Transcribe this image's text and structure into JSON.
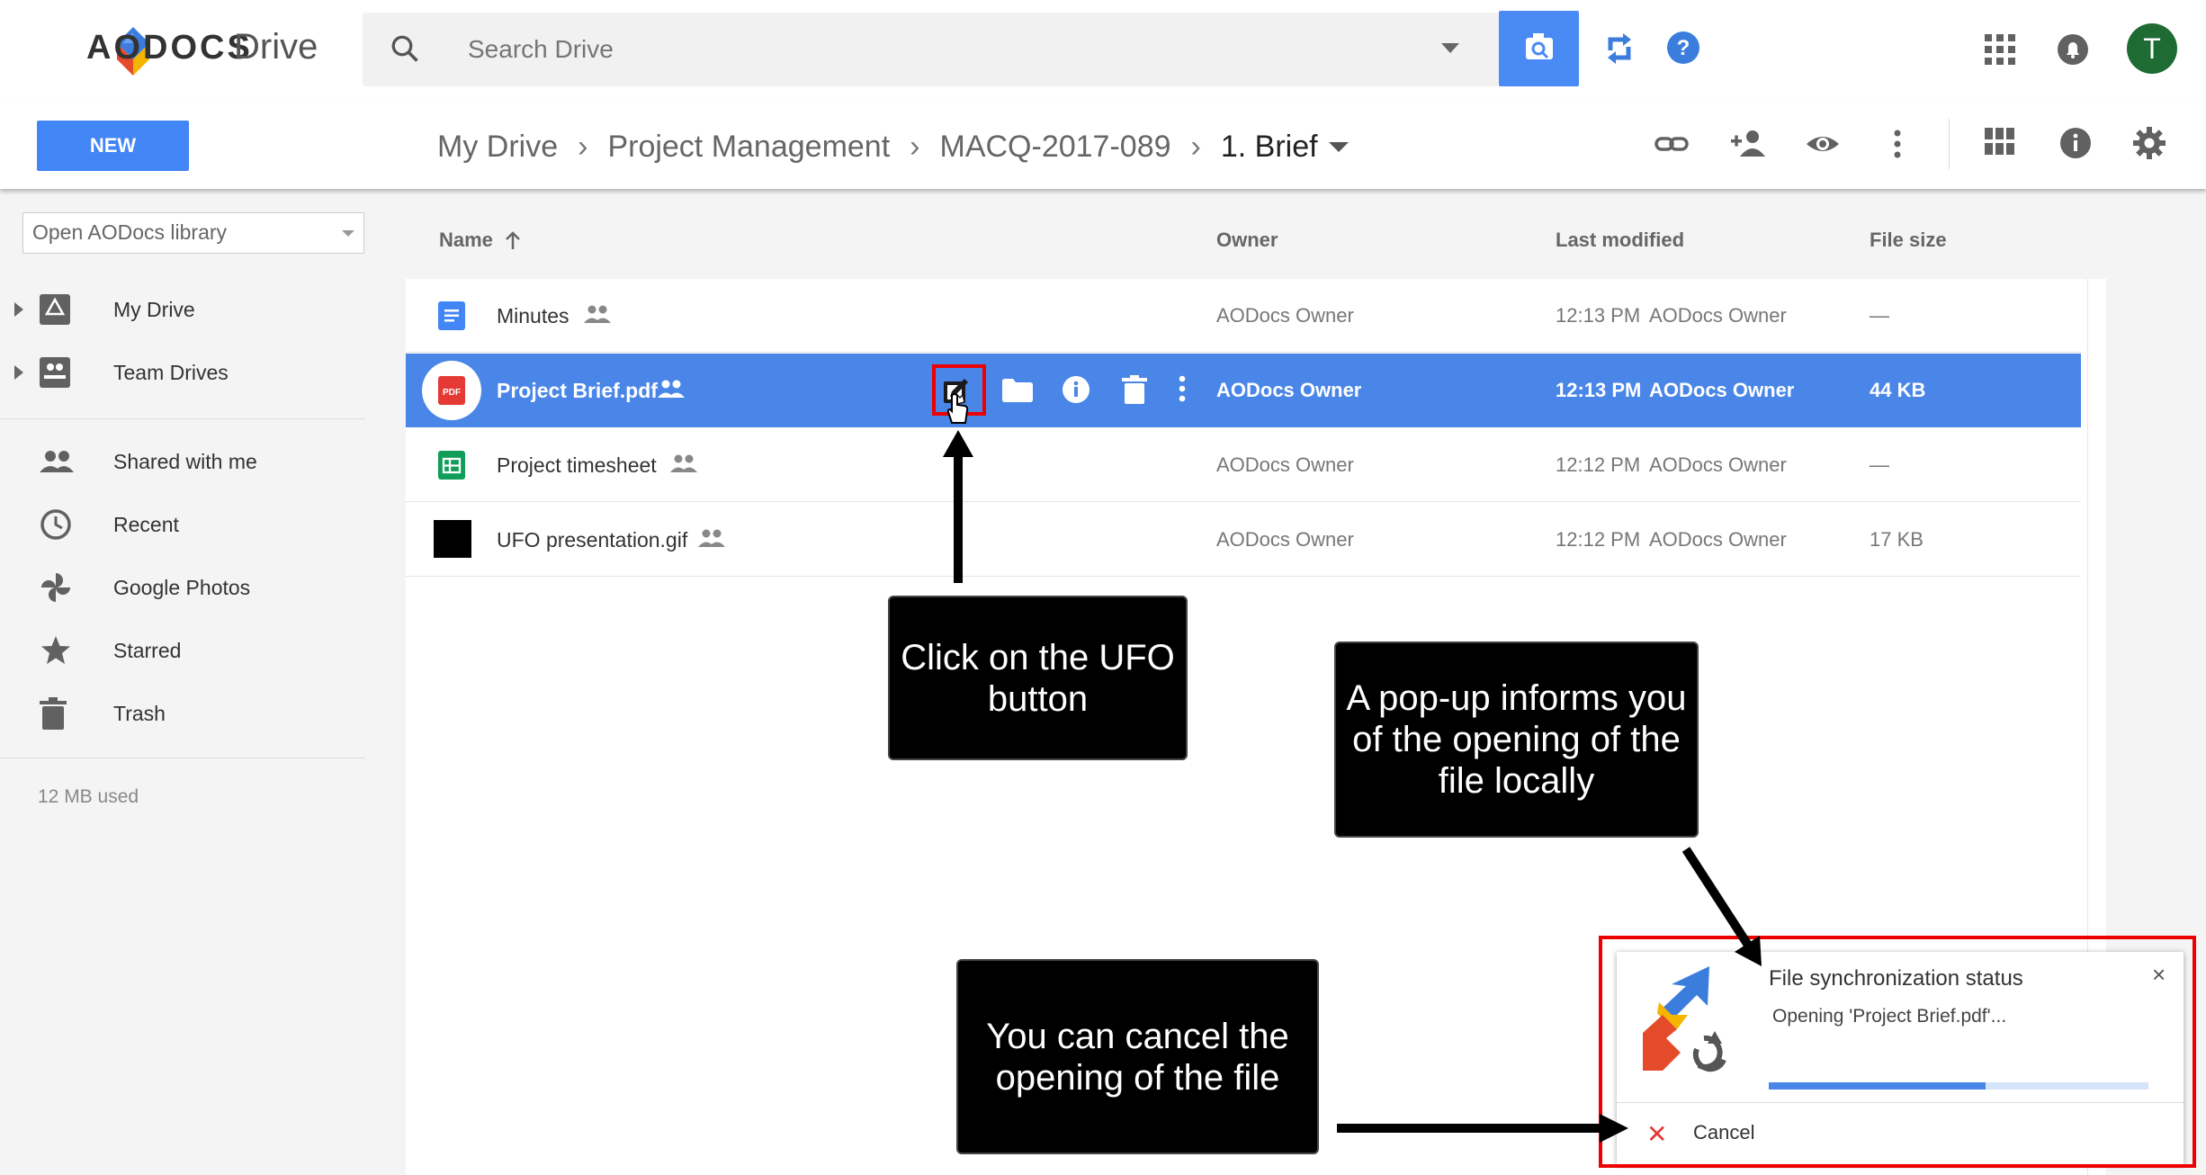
{
  "header": {
    "logo_text": "AODOCS",
    "app_name": "Drive",
    "search_placeholder": "Search Drive",
    "avatar_letter": "T"
  },
  "toolbar": {
    "new_label": "NEW",
    "breadcrumb": [
      "My Drive",
      "Project Management",
      "MACQ-2017-089",
      "1. Brief"
    ]
  },
  "sidebar": {
    "library_select": "Open AODocs library",
    "items": [
      {
        "label": "My Drive",
        "icon": "drive-icon"
      },
      {
        "label": "Team Drives",
        "icon": "team-drive-icon"
      },
      {
        "label": "Shared with me",
        "icon": "people-icon"
      },
      {
        "label": "Recent",
        "icon": "clock-icon"
      },
      {
        "label": "Google Photos",
        "icon": "pinwheel-icon"
      },
      {
        "label": "Starred",
        "icon": "star-icon"
      },
      {
        "label": "Trash",
        "icon": "trash-icon"
      }
    ],
    "storage": "12 MB used"
  },
  "table": {
    "columns": [
      "Name",
      "Owner",
      "Last modified",
      "File size"
    ],
    "rows": [
      {
        "name": "Minutes",
        "owner": "AODocs Owner",
        "time": "12:13 PM",
        "modified_by": "AODocs Owner",
        "size": "—",
        "type": "doc"
      },
      {
        "name": "Project Brief.pdf",
        "owner": "AODocs Owner",
        "time": "12:13 PM",
        "modified_by": "AODocs Owner",
        "size": "44 KB",
        "type": "pdf",
        "selected": true
      },
      {
        "name": "Project timesheet",
        "owner": "AODocs Owner",
        "time": "12:12 PM",
        "modified_by": "AODocs Owner",
        "size": "—",
        "type": "sheet"
      },
      {
        "name": "UFO presentation.gif",
        "owner": "AODocs Owner",
        "time": "12:12 PM",
        "modified_by": "AODocs Owner",
        "size": "17 KB",
        "type": "gif"
      }
    ],
    "pdf_badge": "PDF"
  },
  "callouts": {
    "ufo": "Click on the UFO button",
    "popup": "A pop-up informs you of the opening of the file locally",
    "cancel": "You can cancel the opening of the file"
  },
  "popup": {
    "title": "File synchronization status",
    "message": "Opening 'Project Brief.pdf'...",
    "close": "×",
    "cancel_icon": "✕",
    "cancel_label": "Cancel",
    "progress_percent": 57
  },
  "colors": {
    "accent": "#4285f4",
    "selected_row": "#4a86e8",
    "highlight": "#e00000",
    "avatar": "#1e6b34"
  }
}
